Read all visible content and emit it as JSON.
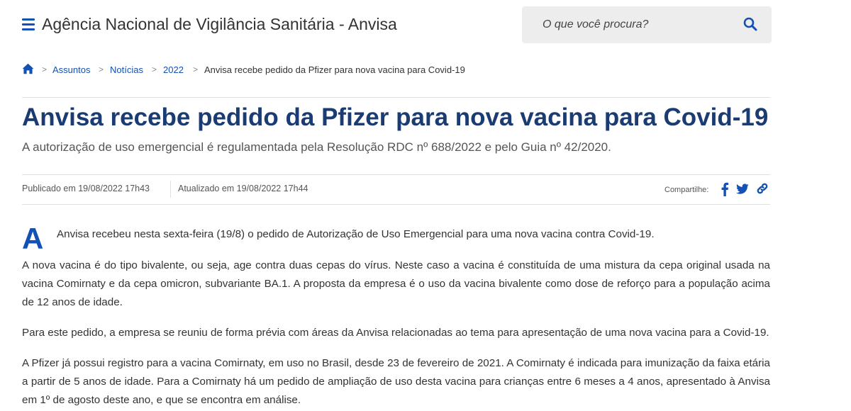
{
  "header": {
    "site_title": "Agência Nacional de Vigilância Sanitária - Anvisa",
    "menu_icon": "hamburger-menu-icon",
    "search": {
      "placeholder": "O que você procura?",
      "icon": "search-icon"
    }
  },
  "breadcrumb": {
    "home_icon": "home-icon",
    "separator": ">",
    "items": [
      {
        "label": "Assuntos"
      },
      {
        "label": "Notícias"
      },
      {
        "label": "2022"
      }
    ],
    "current": "Anvisa recebe pedido da Pfizer para nova vacina para Covid-19"
  },
  "article": {
    "title": "Anvisa recebe pedido da Pfizer para nova vacina para Covid-19",
    "subtitle": "A autorização de uso emergencial é regulamentada pela Resolução RDC nº 688/2022 e pelo Guia nº 42/2020.",
    "published": "Publicado em 19/08/2022 17h43",
    "updated": "Atualizado em 19/08/2022 17h44",
    "share_label": "Compartilhe:",
    "share_icons": [
      "facebook-icon",
      "twitter-icon",
      "link-icon"
    ],
    "dropcap": "A",
    "paragraphs": [
      "Anvisa recebeu nesta sexta-feira (19/8) o pedido de Autorização de Uso Emergencial para uma nova vacina contra Covid-19.",
      "A nova vacina é do tipo bivalente, ou seja, age contra duas cepas do vírus. Neste caso a vacina é constituída de uma mistura da cepa original usada na vacina Comirnaty e da cepa omicron, subvariante BA.1. A proposta da empresa é o uso da vacina bivalente como dose de reforço para a população acima de 12 anos de idade.",
      "Para este pedido, a empresa se reuniu de forma prévia com áreas da Anvisa relacionadas ao tema para apresentação de uma nova vacina para a Covid-19.",
      "A Pfizer já possui registro para a vacina Comirnaty, em uso no Brasil, desde 23 de fevereiro de 2021. A Comirnaty é indicada para imunização da faixa etária a partir de 5 anos de idade. Para a Comirnaty há um pedido de ampliação de uso desta vacina para crianças entre 6 meses a 4 anos, apresentado à Anvisa em 1º de agosto deste ano, e que se encontra em análise."
    ]
  },
  "colors": {
    "link_blue": "#1351b4",
    "title_navy": "#1b3b73",
    "search_bg": "#ededed"
  }
}
